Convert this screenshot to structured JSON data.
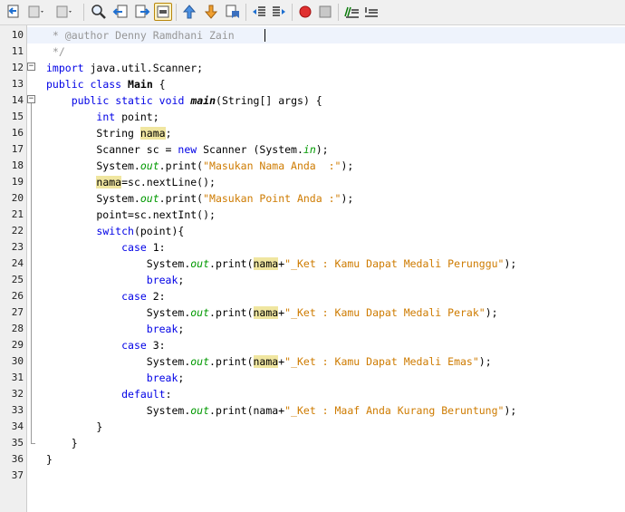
{
  "toolbar": {
    "buttons": [
      {
        "name": "back-button",
        "icon": "back-icon"
      },
      {
        "name": "history-dropdown-button",
        "icon": "history-icon"
      },
      {
        "name": "forward-history-button",
        "icon": "forward-history-icon"
      },
      {
        "name": "find-button",
        "icon": "find-icon"
      },
      {
        "name": "find-previous-button",
        "icon": "find-previous-icon"
      },
      {
        "name": "find-next-button",
        "icon": "find-next-icon"
      },
      {
        "name": "toggle-highlight-button",
        "icon": "highlight-icon",
        "active": true
      },
      {
        "name": "previous-bookmark-button",
        "icon": "bookmark-up-icon"
      },
      {
        "name": "next-bookmark-button",
        "icon": "bookmark-down-icon"
      },
      {
        "name": "toggle-bookmark-button",
        "icon": "bookmark-toggle-icon"
      },
      {
        "name": "shift-left-button",
        "icon": "shift-left-icon"
      },
      {
        "name": "shift-right-button",
        "icon": "shift-right-icon"
      },
      {
        "name": "start-macro-button",
        "icon": "record-icon"
      },
      {
        "name": "stop-macro-button",
        "icon": "stop-icon"
      },
      {
        "name": "comment-button",
        "icon": "comment-icon"
      },
      {
        "name": "uncomment-button",
        "icon": "uncomment-icon"
      }
    ]
  },
  "colors": {
    "keyword": "#0000e6",
    "string": "#ce7b00",
    "comment": "#969696",
    "static_field": "#009900",
    "occurrence_highlight": "#f0e6a0",
    "gutter": "#efefef"
  },
  "editor": {
    "lines": [
      {
        "num": "10",
        "tokens": [
          {
            "t": " * @author Denny Ramdhani Zain",
            "c": "comment"
          }
        ]
      },
      {
        "num": "11",
        "tokens": [
          {
            "t": " */",
            "c": "comment"
          }
        ]
      },
      {
        "num": "12",
        "tokens": [
          {
            "t": "import",
            "c": "kw"
          },
          {
            "t": " java.util.Scanner;",
            "c": ""
          }
        ]
      },
      {
        "num": "13",
        "tokens": [
          {
            "t": "public",
            "c": "kw"
          },
          {
            "t": " ",
            "c": ""
          },
          {
            "t": "class",
            "c": "kw"
          },
          {
            "t": " ",
            "c": ""
          },
          {
            "t": "Main",
            "c": "bold"
          },
          {
            "t": " {",
            "c": ""
          }
        ]
      },
      {
        "num": "14",
        "tokens": [
          {
            "t": "    ",
            "c": ""
          },
          {
            "t": "public",
            "c": "kw"
          },
          {
            "t": " ",
            "c": ""
          },
          {
            "t": "static",
            "c": "kw"
          },
          {
            "t": " ",
            "c": ""
          },
          {
            "t": "void",
            "c": "kw"
          },
          {
            "t": " ",
            "c": ""
          },
          {
            "t": "main",
            "c": "method"
          },
          {
            "t": "(String[] args) {",
            "c": ""
          }
        ]
      },
      {
        "num": "15",
        "tokens": [
          {
            "t": "        ",
            "c": ""
          },
          {
            "t": "int",
            "c": "kw"
          },
          {
            "t": " point;",
            "c": ""
          }
        ]
      },
      {
        "num": "16",
        "tokens": [
          {
            "t": "        String ",
            "c": ""
          },
          {
            "t": "nama",
            "c": "hl"
          },
          {
            "t": ";",
            "c": ""
          }
        ]
      },
      {
        "num": "17",
        "tokens": [
          {
            "t": "        Scanner sc = ",
            "c": ""
          },
          {
            "t": "new",
            "c": "kw"
          },
          {
            "t": " Scanner (System.",
            "c": ""
          },
          {
            "t": "in",
            "c": "field"
          },
          {
            "t": ");",
            "c": ""
          }
        ]
      },
      {
        "num": "18",
        "tokens": [
          {
            "t": "        System.",
            "c": ""
          },
          {
            "t": "out",
            "c": "field"
          },
          {
            "t": ".print(",
            "c": ""
          },
          {
            "t": "\"Masukan Nama Anda  :\"",
            "c": "str"
          },
          {
            "t": ");",
            "c": ""
          }
        ]
      },
      {
        "num": "19",
        "tokens": [
          {
            "t": "        ",
            "c": ""
          },
          {
            "t": "nama",
            "c": "hl"
          },
          {
            "t": "=sc.nextLine();",
            "c": ""
          }
        ]
      },
      {
        "num": "20",
        "tokens": [
          {
            "t": "        System.",
            "c": ""
          },
          {
            "t": "out",
            "c": "field"
          },
          {
            "t": ".print(",
            "c": ""
          },
          {
            "t": "\"Masukan Point Anda :\"",
            "c": "str"
          },
          {
            "t": ");",
            "c": ""
          }
        ]
      },
      {
        "num": "21",
        "tokens": [
          {
            "t": "        point=sc.nextInt();",
            "c": ""
          }
        ]
      },
      {
        "num": "22",
        "tokens": [
          {
            "t": "        ",
            "c": ""
          },
          {
            "t": "switch",
            "c": "kw"
          },
          {
            "t": "(point){",
            "c": ""
          }
        ]
      },
      {
        "num": "23",
        "tokens": [
          {
            "t": "            ",
            "c": ""
          },
          {
            "t": "case",
            "c": "kw"
          },
          {
            "t": " 1:",
            "c": ""
          }
        ]
      },
      {
        "num": "24",
        "tokens": [
          {
            "t": "                System.",
            "c": ""
          },
          {
            "t": "out",
            "c": "field"
          },
          {
            "t": ".print(",
            "c": ""
          },
          {
            "t": "nama",
            "c": "hl"
          },
          {
            "t": "+",
            "c": ""
          },
          {
            "t": "\"_Ket : Kamu Dapat Medali Perunggu\"",
            "c": "str"
          },
          {
            "t": ");",
            "c": ""
          }
        ]
      },
      {
        "num": "25",
        "tokens": [
          {
            "t": "                ",
            "c": ""
          },
          {
            "t": "break",
            "c": "kw"
          },
          {
            "t": ";",
            "c": ""
          }
        ]
      },
      {
        "num": "26",
        "tokens": [
          {
            "t": "            ",
            "c": ""
          },
          {
            "t": "case",
            "c": "kw"
          },
          {
            "t": " 2:",
            "c": ""
          }
        ]
      },
      {
        "num": "27",
        "tokens": [
          {
            "t": "                System.",
            "c": ""
          },
          {
            "t": "out",
            "c": "field"
          },
          {
            "t": ".print(",
            "c": ""
          },
          {
            "t": "nama",
            "c": "hl"
          },
          {
            "t": "+",
            "c": ""
          },
          {
            "t": "\"_Ket : Kamu Dapat Medali Perak\"",
            "c": "str"
          },
          {
            "t": ");",
            "c": ""
          }
        ]
      },
      {
        "num": "28",
        "tokens": [
          {
            "t": "                ",
            "c": ""
          },
          {
            "t": "break",
            "c": "kw"
          },
          {
            "t": ";",
            "c": ""
          }
        ]
      },
      {
        "num": "29",
        "tokens": [
          {
            "t": "            ",
            "c": ""
          },
          {
            "t": "case",
            "c": "kw"
          },
          {
            "t": " 3:",
            "c": ""
          }
        ]
      },
      {
        "num": "30",
        "tokens": [
          {
            "t": "                System.",
            "c": ""
          },
          {
            "t": "out",
            "c": "field"
          },
          {
            "t": ".print(",
            "c": ""
          },
          {
            "t": "nama",
            "c": "hl"
          },
          {
            "t": "+",
            "c": ""
          },
          {
            "t": "\"_Ket : Kamu Dapat Medali Emas\"",
            "c": "str"
          },
          {
            "t": ");",
            "c": ""
          }
        ]
      },
      {
        "num": "31",
        "tokens": [
          {
            "t": "                ",
            "c": ""
          },
          {
            "t": "break",
            "c": "kw"
          },
          {
            "t": ";",
            "c": ""
          }
        ]
      },
      {
        "num": "32",
        "tokens": [
          {
            "t": "            ",
            "c": ""
          },
          {
            "t": "default",
            "c": "kw"
          },
          {
            "t": ":",
            "c": ""
          }
        ]
      },
      {
        "num": "33",
        "tokens": [
          {
            "t": "                System.",
            "c": ""
          },
          {
            "t": "out",
            "c": "field"
          },
          {
            "t": ".print(nama+",
            "c": ""
          },
          {
            "t": "\"_Ket : Maaf Anda Kurang Beruntung\"",
            "c": "str"
          },
          {
            "t": ");",
            "c": ""
          }
        ]
      },
      {
        "num": "34",
        "tokens": [
          {
            "t": "        }",
            "c": ""
          }
        ]
      },
      {
        "num": "35",
        "tokens": [
          {
            "t": "    }",
            "c": ""
          }
        ]
      },
      {
        "num": "36",
        "tokens": [
          {
            "t": "}",
            "c": ""
          }
        ]
      },
      {
        "num": "37",
        "tokens": []
      }
    ]
  }
}
